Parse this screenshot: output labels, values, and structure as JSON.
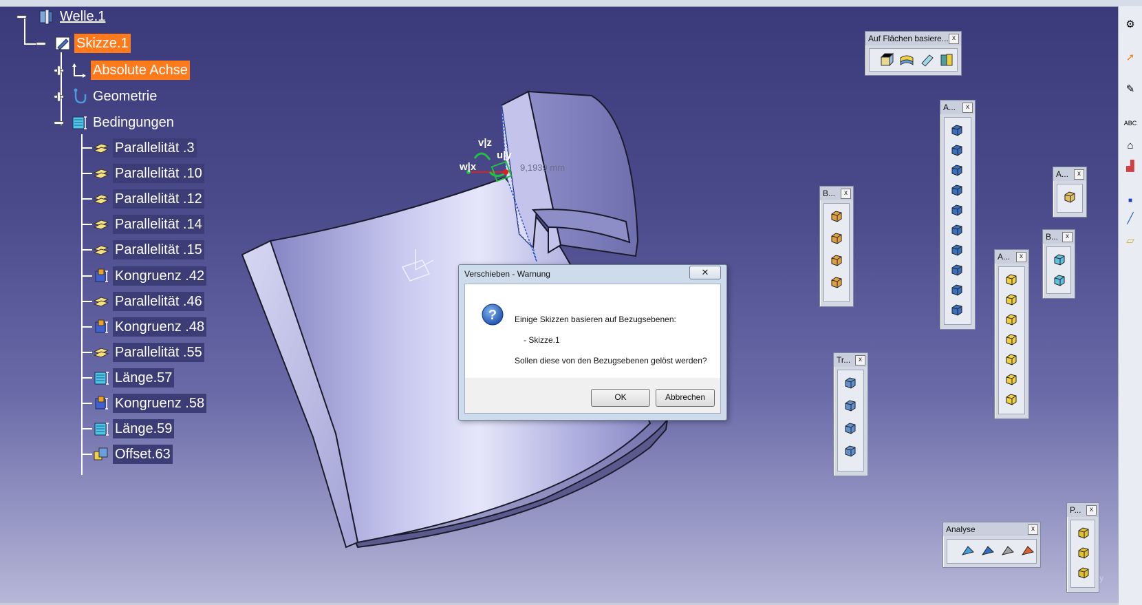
{
  "tree": {
    "root": {
      "label": "Welle.1",
      "icon": "part-body-icon"
    },
    "sketch": {
      "label": "Skizze.1",
      "icon": "sketch-icon"
    },
    "children": [
      {
        "label": "Absolute Achse",
        "icon": "axis-icon"
      },
      {
        "label": "Geometrie",
        "icon": "geometry-icon"
      },
      {
        "label": "Bedingungen",
        "icon": "constraints-icon"
      }
    ],
    "constraints": [
      {
        "label": "Parallelität .3",
        "icon": "parallelism-icon"
      },
      {
        "label": "Parallelität .10",
        "icon": "parallelism-icon"
      },
      {
        "label": "Parallelität .12",
        "icon": "parallelism-icon"
      },
      {
        "label": "Parallelität .14",
        "icon": "parallelism-icon"
      },
      {
        "label": "Parallelität .15",
        "icon": "parallelism-icon"
      },
      {
        "label": "Kongruenz .42",
        "icon": "coincidence-icon"
      },
      {
        "label": "Parallelität .46",
        "icon": "parallelism-icon"
      },
      {
        "label": "Kongruenz .48",
        "icon": "coincidence-icon"
      },
      {
        "label": "Parallelität .55",
        "icon": "parallelism-icon"
      },
      {
        "label": "Länge.57",
        "icon": "length-icon"
      },
      {
        "label": "Kongruenz .58",
        "icon": "coincidence-icon"
      },
      {
        "label": "Länge.59",
        "icon": "length-icon"
      },
      {
        "label": "Offset.63",
        "icon": "offset-icon"
      }
    ]
  },
  "viewport": {
    "compass_labels": {
      "vz": "v|z",
      "uy": "u|y",
      "wx": "w|x"
    },
    "measure": "9,1939 mm",
    "axis_y_small": "y"
  },
  "toolbars": {
    "surface_based": "Auf Flächen basiere...",
    "a1": "A...",
    "a2": "A...",
    "a3": "A...",
    "b1": "B...",
    "b2": "B...",
    "tr": "Tr...",
    "p": "P...",
    "analyse": "Analyse",
    "close": "x"
  },
  "dialog": {
    "title": "Verschieben - Warnung",
    "close": "✕",
    "line1": "Einige Skizzen basieren auf Bezugsebenen:",
    "line2": "- Skizze.1",
    "line3": "Sollen diese von den Bezugsebenen gelöst werden?",
    "ok": "OK",
    "cancel": "Abbrechen"
  },
  "colors": {
    "highlight": "#ff7a1a",
    "selection": "#3c3c76",
    "part_face": "#b4b4e6"
  }
}
